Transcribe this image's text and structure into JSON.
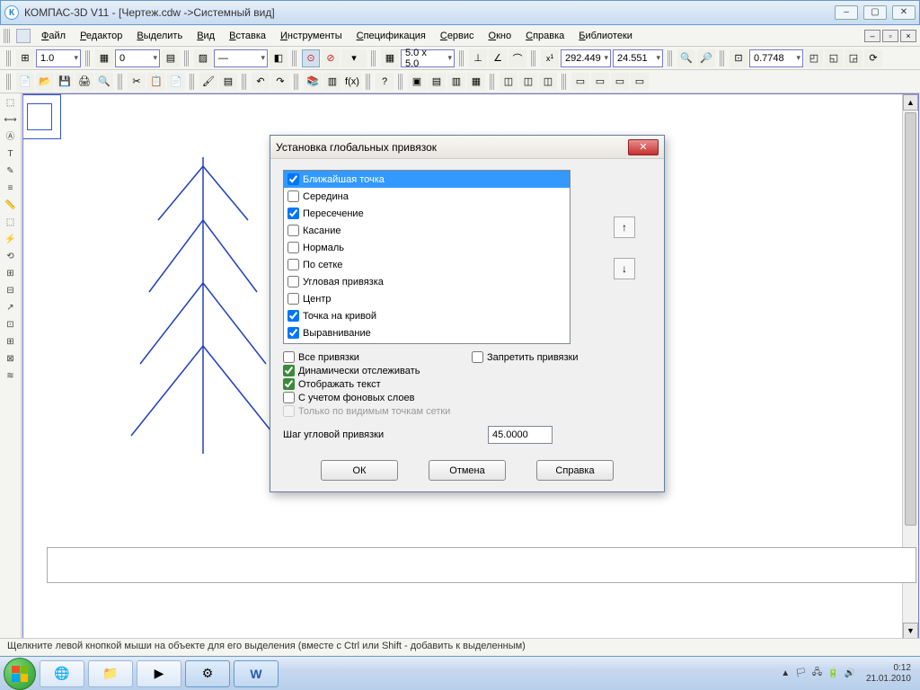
{
  "title": "КОМПАС-3D V11 - [Чертеж.cdw ->Системный вид]",
  "menu": [
    "Файл",
    "Редактор",
    "Выделить",
    "Вид",
    "Вставка",
    "Инструменты",
    "Спецификация",
    "Сервис",
    "Окно",
    "Справка",
    "Библиотеки"
  ],
  "tb1": {
    "combo1": "1.0",
    "combo2": "0",
    "grid": "5.0 x 5.0",
    "coordX": "292.449",
    "coordY": "24.551",
    "zoom": "0.7748"
  },
  "dialog": {
    "title": "Установка глобальных привязок",
    "items": [
      {
        "label": "Ближайшая точка",
        "checked": true,
        "sel": true
      },
      {
        "label": "Середина",
        "checked": false
      },
      {
        "label": "Пересечение",
        "checked": true
      },
      {
        "label": "Касание",
        "checked": false
      },
      {
        "label": "Нормаль",
        "checked": false
      },
      {
        "label": "По сетке",
        "checked": false
      },
      {
        "label": "Угловая привязка",
        "checked": false
      },
      {
        "label": "Центр",
        "checked": false
      },
      {
        "label": "Точка на кривой",
        "checked": true
      },
      {
        "label": "Выравнивание",
        "checked": true
      }
    ],
    "opts": {
      "all": {
        "label": "Все привязки",
        "checked": false
      },
      "forbid": {
        "label": "Запретить привязки",
        "checked": false
      },
      "dynamic": {
        "label": "Динамически отслеживать",
        "checked": true
      },
      "showtext": {
        "label": "Отображать текст",
        "checked": true
      },
      "bglayers": {
        "label": "С учетом фоновых слоев",
        "checked": false
      },
      "gridvis": {
        "label": "Только по видимым точкам сетки",
        "checked": false
      }
    },
    "step_label": "Шаг угловой привязки",
    "step_value": "45.0000",
    "btn_ok": "ОК",
    "btn_cancel": "Отмена",
    "btn_help": "Справка"
  },
  "status": "Щелкните левой кнопкой мыши на объекте для его выделения (вместе с Ctrl или Shift - добавить к выделенным)",
  "clock": {
    "time": "0:12",
    "date": "21.01.2010"
  }
}
